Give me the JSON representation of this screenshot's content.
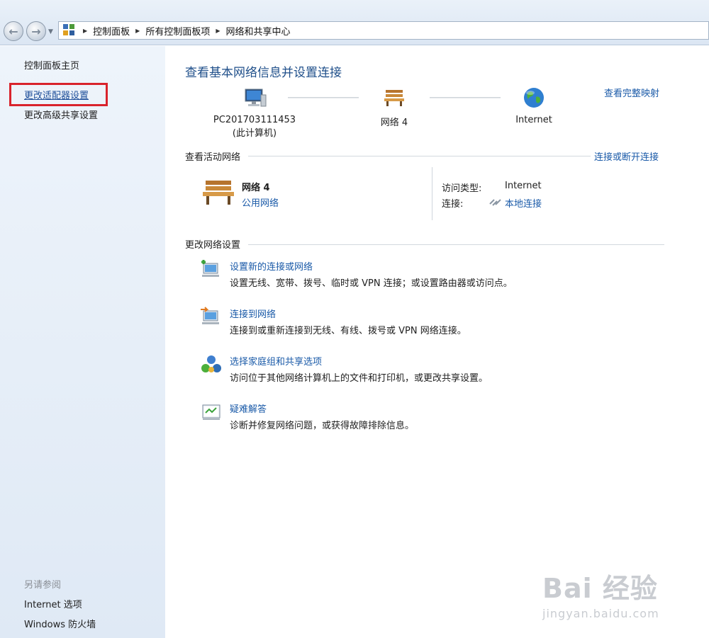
{
  "breadcrumb": {
    "items": [
      "控制面板",
      "所有控制面板项",
      "网络和共享中心"
    ]
  },
  "sidebar": {
    "home": "控制面板主页",
    "adapter": "更改适配器设置",
    "sharing": "更改高级共享设置",
    "see_also_title": "另请参阅",
    "see_also": [
      "Internet 选项",
      "Windows 防火墙"
    ]
  },
  "main": {
    "title": "查看基本网络信息并设置连接",
    "full_map": "查看完整映射",
    "map": {
      "computer_name": "PC201703111453",
      "computer_sub": "(此计算机)",
      "network_name": "网络  4",
      "internet": "Internet"
    },
    "active": {
      "section_title": "查看活动网络",
      "toggle": "连接或断开连接",
      "network_name": "网络  4",
      "network_type": "公用网络",
      "access_label": "访问类型:",
      "access_value": "Internet",
      "conn_label": "连接:",
      "conn_value": "本地连接"
    },
    "change": {
      "section_title": "更改网络设置",
      "tasks": [
        {
          "link": "设置新的连接或网络",
          "desc": "设置无线、宽带、拨号、临时或 VPN 连接；或设置路由器或访问点。"
        },
        {
          "link": "连接到网络",
          "desc": "连接到或重新连接到无线、有线、拨号或 VPN 网络连接。"
        },
        {
          "link": "选择家庭组和共享选项",
          "desc": "访问位于其他网络计算机上的文件和打印机，或更改共享设置。"
        },
        {
          "link": "疑难解答",
          "desc": "诊断并修复网络问题，或获得故障排除信息。"
        }
      ]
    }
  },
  "watermark": {
    "brand": "Bai  经验",
    "url": "jingyan.baidu.com"
  },
  "colors": {
    "link": "#1a5aa8",
    "title": "#1f4f8a",
    "highlight_box": "#d9232c",
    "sidebar_bg": "#e6eef8"
  }
}
